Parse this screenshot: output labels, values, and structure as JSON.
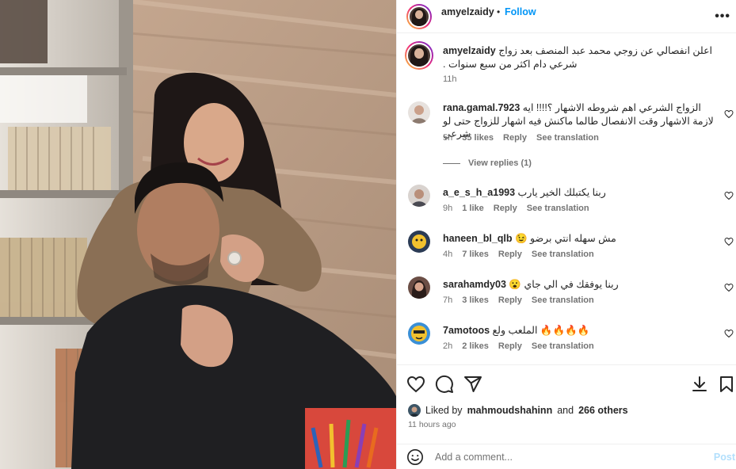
{
  "post": {
    "username": "amyelzaidy",
    "separator": "•",
    "follow_label": "Follow",
    "more_label": "•••",
    "caption": "اعلن انفصالي عن زوجي محمد عبد المنصف بعد زواج شرعي دام اكثر من سبع سنوات .",
    "caption_time": "11h"
  },
  "comments": [
    {
      "username": "rana.gamal.7923",
      "text": "الزواج الشرعي اهم شروطه الاشهار ؟!!!! ايه لازمة الاشهار وقت الانفصال طالما ماكنش فيه اشهار للزواج حتى لو شرعي",
      "time": "5h",
      "likes": "35 likes",
      "reply": "Reply",
      "translate": "See translation"
    },
    {
      "username": "a_e_s_h_a1993",
      "text": "ربنا يكتبلك الخير يارب",
      "time": "9h",
      "likes": "1 like",
      "reply": "Reply",
      "translate": "See translation"
    },
    {
      "username": "haneen_bl_qlb",
      "text": "مش سهله انتي برضو 😉",
      "time": "4h",
      "likes": "7 likes",
      "reply": "Reply",
      "translate": "See translation"
    },
    {
      "username": "sarahamdy03",
      "text": "ربنا يوفقك في الي جاي 😮",
      "time": "7h",
      "likes": "3 likes",
      "reply": "Reply",
      "translate": "See translation"
    },
    {
      "username": "7amotoos",
      "text": "🔥🔥🔥🔥 الملعب ولع",
      "time": "2h",
      "likes": "2 likes",
      "reply": "Reply",
      "translate": "See translation"
    }
  ],
  "view_replies_label": "View replies (1)",
  "actions": {
    "like_icon": "heart-icon",
    "comment_icon": "comment-icon",
    "share_icon": "share-icon",
    "download_icon": "download-icon",
    "save_icon": "bookmark-icon"
  },
  "likes_summary": {
    "prefix": "Liked by",
    "user": "mahmoudshahinn",
    "middle": "and",
    "others": "266 others"
  },
  "posted_ago": "11 hours ago",
  "add_comment": {
    "placeholder": "Add a comment...",
    "post_label": "Post"
  },
  "colors": {
    "link_blue": "#0095f6",
    "muted": "#737373",
    "post_disabled": "#b2dffc"
  }
}
